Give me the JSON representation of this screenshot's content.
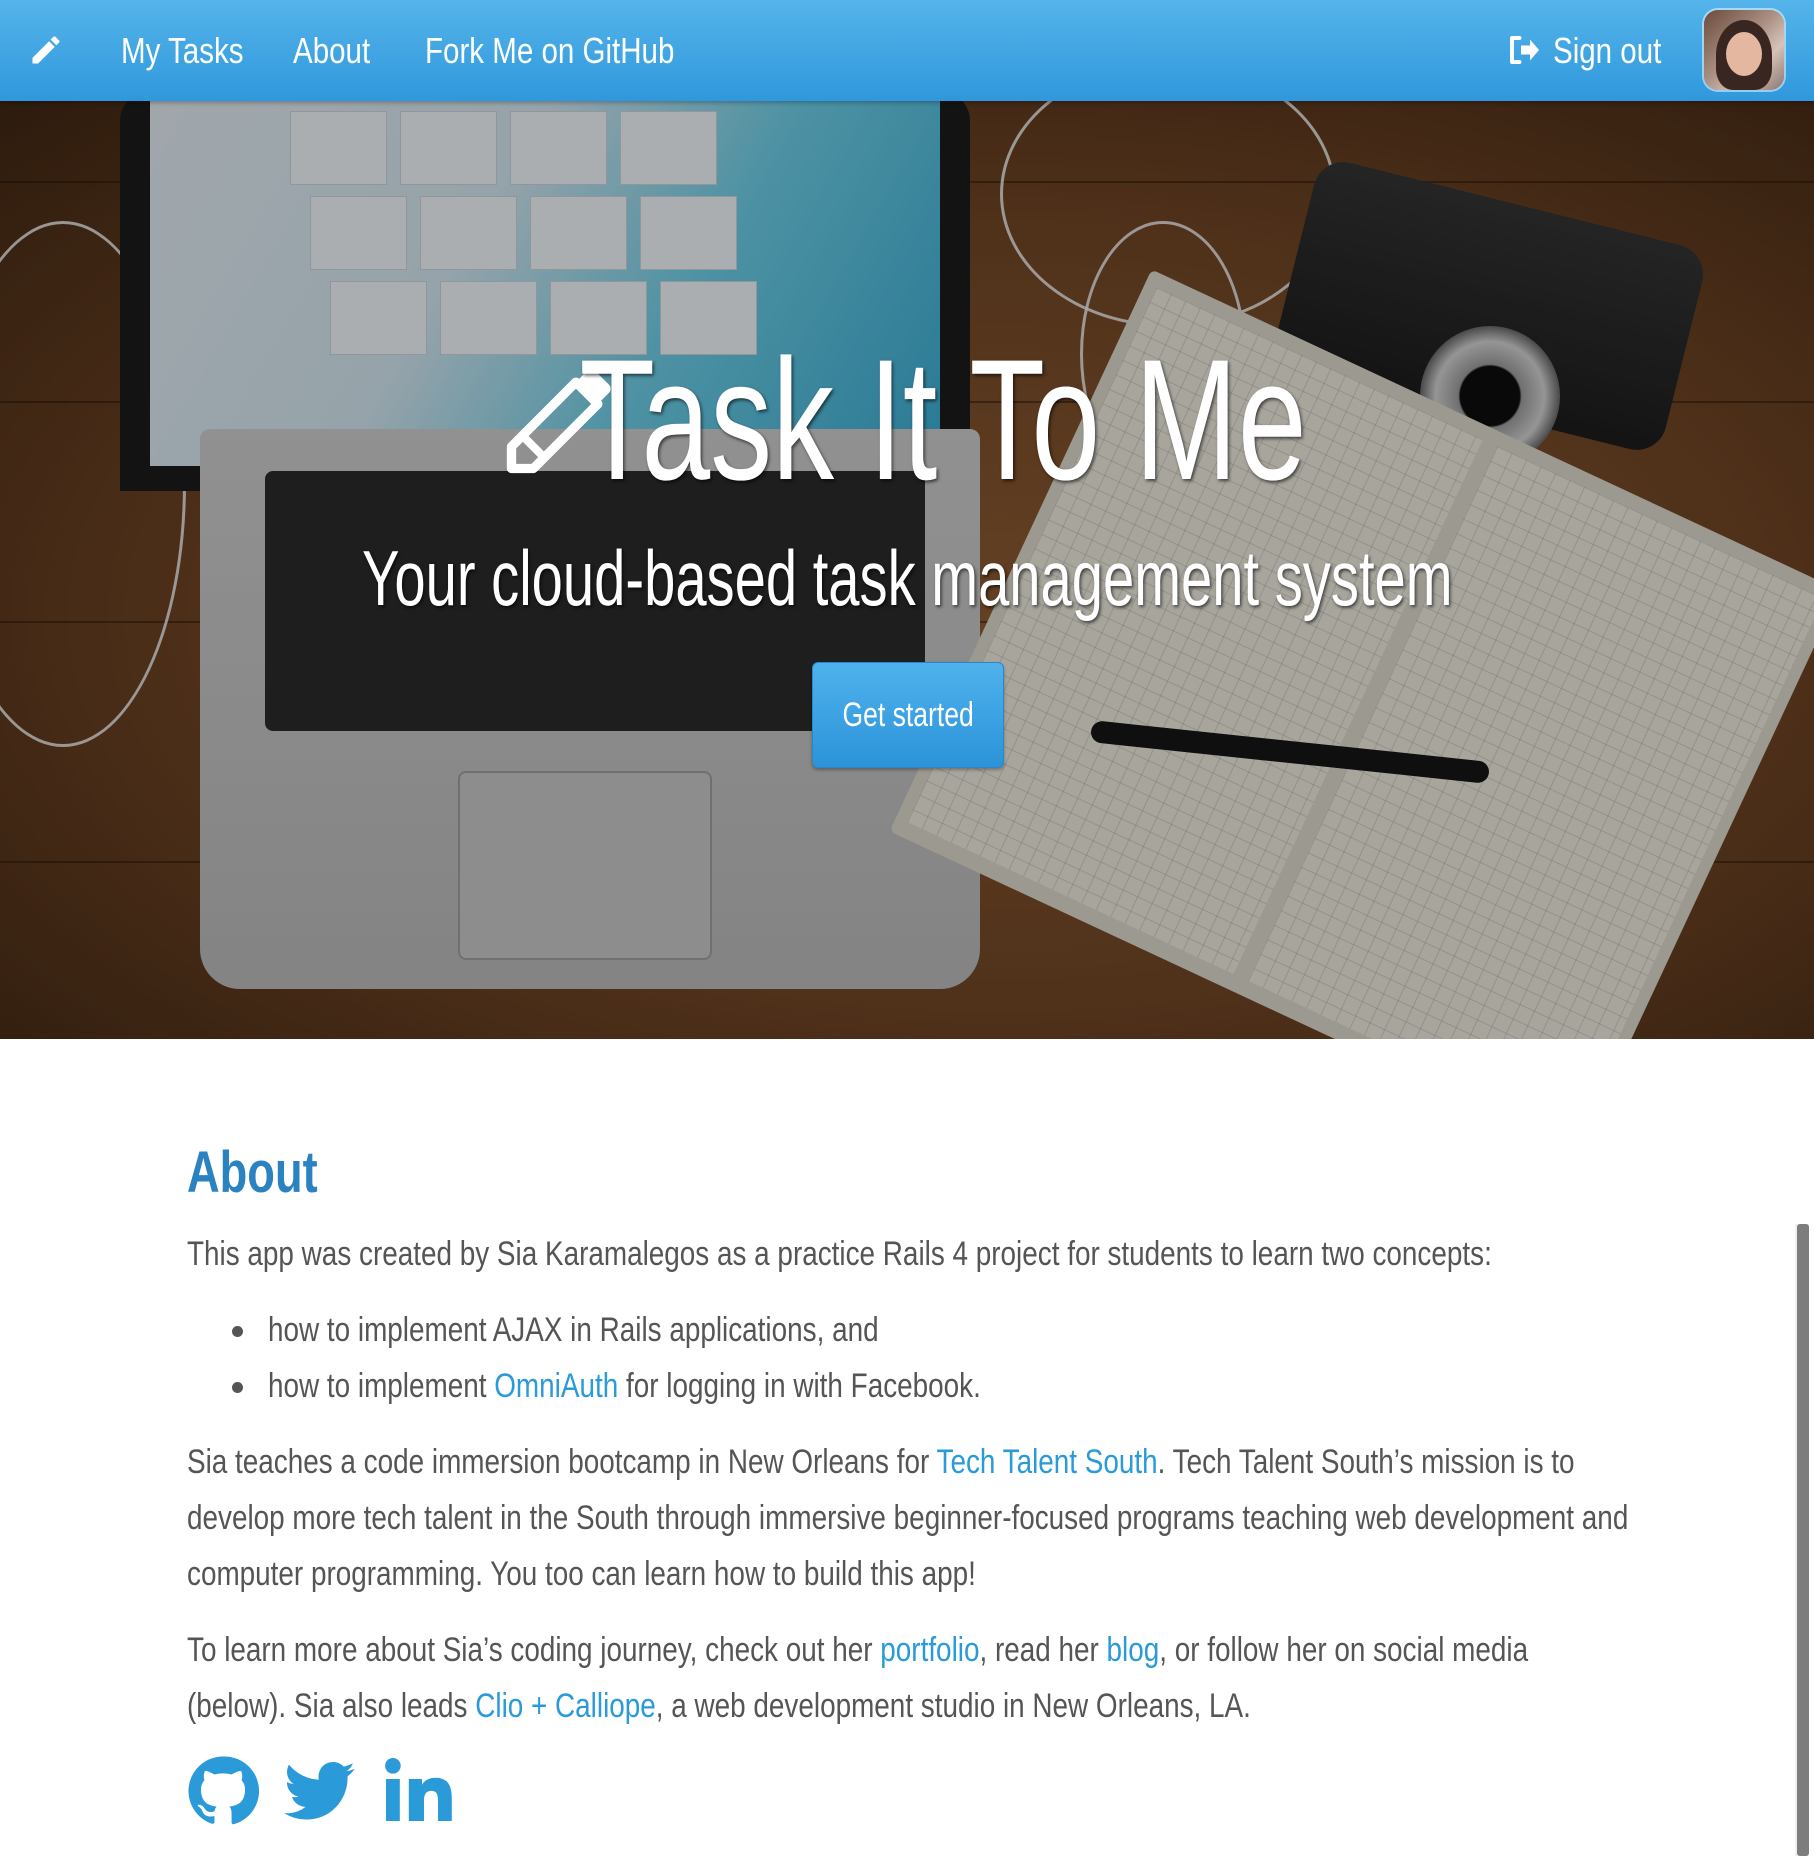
{
  "navbar": {
    "brand_icon": "pencil-icon",
    "items": [
      {
        "label": "My Tasks"
      },
      {
        "label": "About"
      },
      {
        "label": "Fork Me on GitHub"
      }
    ],
    "signout_label": "Sign out",
    "signout_icon": "sign-out-icon",
    "accent_color": "#3aa3e3"
  },
  "hero": {
    "title": "Task It To Me",
    "title_icon": "pencil-icon",
    "subtitle": "Your cloud-based task management system",
    "cta_label": "Get started"
  },
  "about": {
    "heading": "About",
    "intro": "This app was created by Sia Karamalegos as a practice Rails 4 project for students to learn two concepts:",
    "bullets": {
      "item1": "how to implement AJAX in Rails applications, and",
      "item2_before": "how to implement ",
      "item2_link": "OmniAuth",
      "item2_after": " for logging in with Facebook."
    },
    "teach": {
      "line1_before": "Sia teaches a code immersion bootcamp in New Orleans for ",
      "line1_link": "Tech Talent South",
      "line1_after": ". Tech Talent South’s mission is to",
      "line2": "develop more tech talent in the South through immersive beginner-focused programs teaching web development and",
      "line3": "computer programming. You too can learn how to build this app!"
    },
    "learn": {
      "line1_before": "To learn more about Sia’s coding journey, check out her ",
      "portfolio_link": "portfolio",
      "mid": ", read her ",
      "blog_link": "blog",
      "line1_after": ", or follow her on social media",
      "line2_before": "(below). Sia also leads ",
      "studio_link": "Clio + Calliope",
      "line2_after": ", a web development studio in New Orleans, LA."
    },
    "social_icons": [
      "github-icon",
      "twitter-icon",
      "linkedin-icon"
    ],
    "link_color": "#2a9ad8",
    "heading_color": "#2a82c0"
  }
}
